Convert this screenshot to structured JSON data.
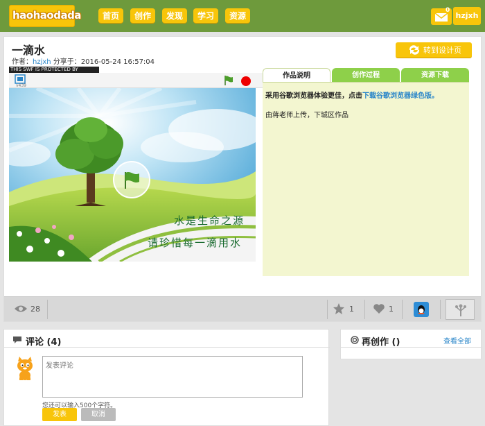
{
  "header": {
    "logo": "haohaodada",
    "nav": [
      "首页",
      "创作",
      "发现",
      "学习",
      "资源"
    ],
    "mail_count": "0",
    "username": "hzjxh"
  },
  "project": {
    "title": "一滴水",
    "author_label": "作者：",
    "author": "hzjxh",
    "shared_label": "分享于：",
    "shared_at": "2016-05-24 16:57:04",
    "design_button": "转到设计页"
  },
  "player": {
    "protected_text": "THIS SWF IS PROTECTED BY",
    "version": "v439",
    "stage_line1": "水是生命之源",
    "stage_line2": "请珍惜每一滴用水"
  },
  "tabs": {
    "items": [
      "作品说明",
      "创作过程",
      "资源下载"
    ],
    "tip_prefix": "采用谷歌浏览器体验更佳，点击",
    "tip_link": "下载谷歌浏览器绿色版。",
    "description": "由蒋老师上传，下城区作品"
  },
  "stats": {
    "views": "28",
    "stars": "1",
    "likes": "1"
  },
  "comments": {
    "title": "评论 (4)",
    "placeholder": "发表评论",
    "char_hint": "您还可以输入500个字符。",
    "send": "发表",
    "cancel": "取消"
  },
  "recreate": {
    "title": "再创作 ()",
    "view_all": "查看全部"
  },
  "colors": {
    "nav_green": "#6e9a3c",
    "accent_yellow": "#f8c50a",
    "link_blue": "#2a86c9",
    "tab_active": "#ffffff",
    "tab_inactive": "#8ed04a",
    "panel_bg": "#f3f6d0"
  }
}
